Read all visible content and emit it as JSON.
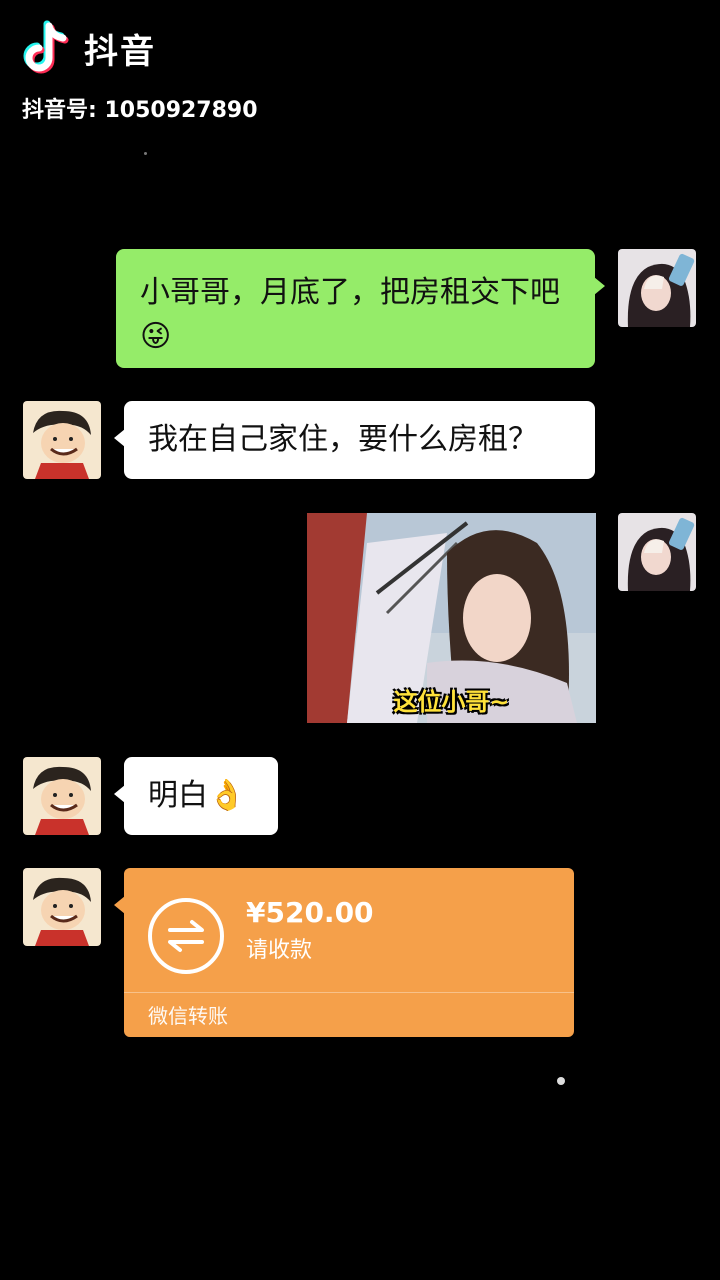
{
  "watermark": {
    "app_name": "抖音",
    "douyin_id": "抖音号: 1050927890"
  },
  "messages": [
    {
      "side": "right",
      "type": "text",
      "text": "小哥哥，月底了，把房租交下吧😜"
    },
    {
      "side": "left",
      "type": "text",
      "text": "我在自己家住，要什么房租？"
    },
    {
      "side": "right",
      "type": "image",
      "caption": "这位小哥~"
    },
    {
      "side": "left",
      "type": "text",
      "text": "明白👌"
    },
    {
      "side": "left",
      "type": "transfer",
      "amount": "¥520.00",
      "status": "请收款",
      "footer": "微信转账"
    }
  ],
  "colors": {
    "self_bubble": "#95EC69",
    "other_bubble": "#FFFFFF",
    "transfer": "#F5A04A",
    "background": "#000000"
  },
  "icons": [
    "tiktok-logo-icon",
    "transfer-arrows-icon"
  ]
}
